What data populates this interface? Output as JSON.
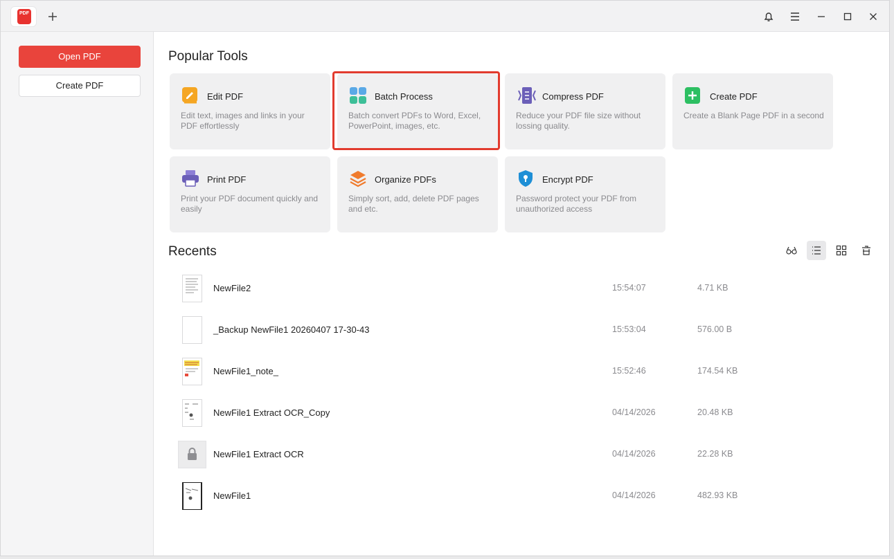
{
  "titlebar": {
    "logo_text": "PDF",
    "icons": [
      "plus-icon",
      "bell-icon",
      "menu-icon",
      "minimize-icon",
      "maximize-icon",
      "close-icon"
    ]
  },
  "sidebar": {
    "open_label": "Open PDF",
    "create_label": "Create PDF"
  },
  "popular": {
    "title": "Popular Tools",
    "tools": [
      {
        "title": "Edit PDF",
        "desc": "Edit text, images and links in your PDF effortlessly",
        "icon": "edit-icon"
      },
      {
        "title": "Batch Process",
        "desc": "Batch convert PDFs to Word, Excel, PowerPoint, images, etc.",
        "icon": "batch-icon"
      },
      {
        "title": "Compress PDF",
        "desc": "Reduce your PDF file size without lossing quality.",
        "icon": "compress-icon"
      },
      {
        "title": "Create PDF",
        "desc": "Create a Blank Page PDF in a second",
        "icon": "create-icon"
      },
      {
        "title": "Print PDF",
        "desc": "Print your PDF document quickly and easily",
        "icon": "print-icon"
      },
      {
        "title": "Organize PDFs",
        "desc": "Simply sort, add, delete PDF pages and etc.",
        "icon": "organize-icon"
      },
      {
        "title": "Encrypt PDF",
        "desc": "Password protect your PDF from unauthorized access",
        "icon": "shield-icon"
      }
    ]
  },
  "recents": {
    "title": "Recents",
    "files": [
      {
        "name": "NewFile2",
        "time": "15:54:07",
        "size": "4.71 KB"
      },
      {
        "name": "_Backup NewFile1 20260407 17-30-43",
        "time": "15:53:04",
        "size": "576.00 B"
      },
      {
        "name": "NewFile1_note_",
        "time": "15:52:46",
        "size": "174.54 KB"
      },
      {
        "name": "NewFile1 Extract OCR_Copy",
        "time": "04/14/2026",
        "size": "20.48 KB"
      },
      {
        "name": "NewFile1 Extract OCR",
        "time": "04/14/2026",
        "size": "22.28 KB"
      },
      {
        "name": "NewFile1",
        "time": "04/14/2026",
        "size": "482.93 KB"
      }
    ]
  },
  "colors": {
    "accent": "#e9443c",
    "highlight": "#e23b2e"
  }
}
